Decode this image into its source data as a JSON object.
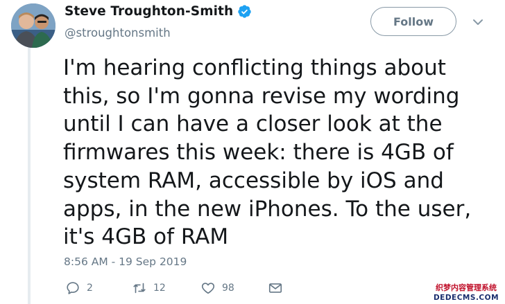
{
  "tweet": {
    "author": {
      "display_name": "Steve Troughton-Smith",
      "handle": "@stroughtonsmith",
      "verified": true,
      "avatar_icon": "avatar-two-men-photo"
    },
    "follow_label": "Follow",
    "lines": [
      "I'm hearing conflicting things about",
      "this, so I'm gonna revise my wording",
      "until I can have a closer look at the",
      "firmwares this week: there is 4GB of",
      "system RAM, accessible by iOS and",
      "apps, in the new iPhones. To the user,",
      "it's 4GB of RAM"
    ],
    "timestamp": "8:56 AM - 19 Sep 2019",
    "actions": {
      "reply_count": "2",
      "retweet_count": "12",
      "like_count": "98"
    }
  },
  "watermark": {
    "top_text": "织梦内容管理系统",
    "bottom_text": "DEDECMS.COM"
  },
  "colors": {
    "text": "#14171a",
    "secondary": "#657786",
    "verified_blue": "#1da1f2",
    "thread_line": "#e6ecf0"
  }
}
